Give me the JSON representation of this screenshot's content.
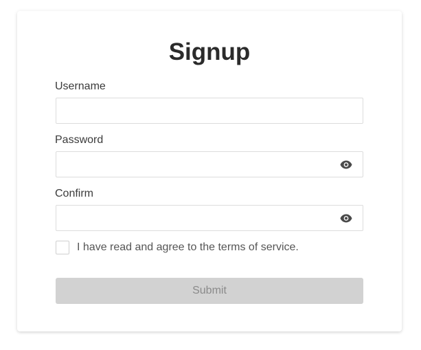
{
  "form": {
    "title": "Signup",
    "username": {
      "label": "Username",
      "value": "",
      "placeholder": ""
    },
    "password": {
      "label": "Password",
      "value": "",
      "placeholder": "",
      "toggle_icon": "eye-icon"
    },
    "confirm": {
      "label": "Confirm",
      "value": "",
      "placeholder": "",
      "toggle_icon": "eye-icon"
    },
    "terms": {
      "label": "I have read and agree to the terms of service.",
      "checked": false
    },
    "submit": {
      "label": "Submit",
      "enabled": false
    }
  },
  "colors": {
    "title": "#2b2b2b",
    "label": "#3a3a3a",
    "input_border": "#dcdcdc",
    "icon": "#4a4a4a",
    "submit_bg_disabled": "#d2d2d2",
    "submit_text_disabled": "#8a8a8a"
  }
}
